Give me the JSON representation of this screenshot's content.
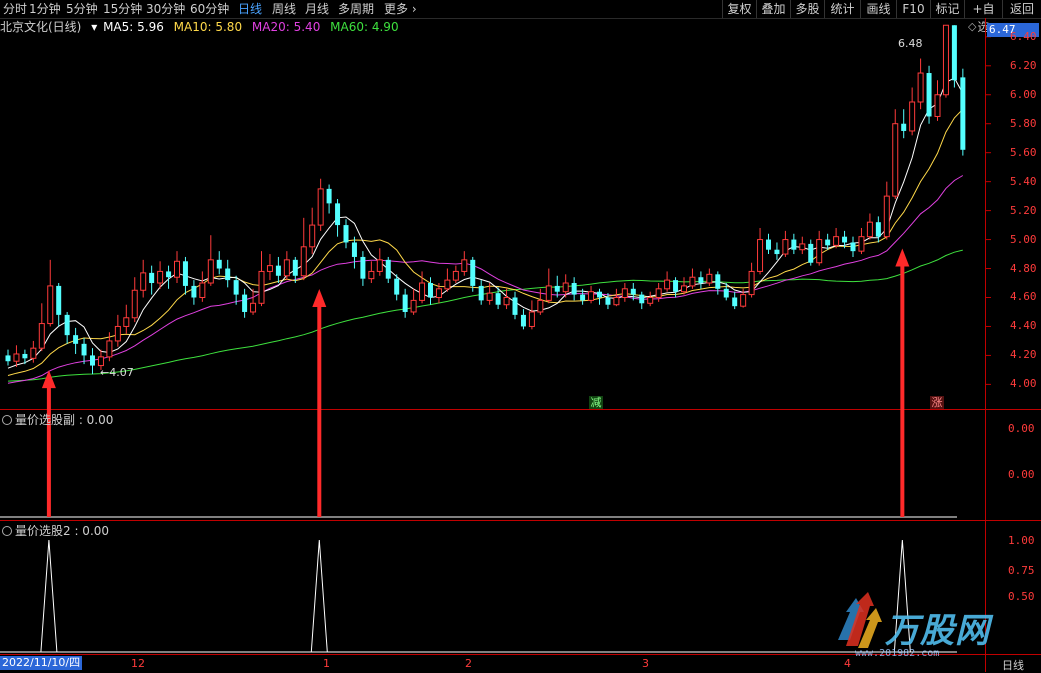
{
  "toolbar": {
    "left_items": [
      "分时",
      "1分钟",
      "5分钟",
      "15分钟",
      "30分钟",
      "60分钟",
      "日线",
      "周线",
      "月线",
      "多周期",
      "更多"
    ],
    "active": "日线",
    "right_items": [
      "复权",
      "叠加",
      "多股",
      "统计",
      "画线",
      "F10",
      "标记",
      "+自选",
      "返回"
    ]
  },
  "stock": {
    "title": "北京文化(日线)"
  },
  "ma_legend": [
    {
      "label": "MA5: 5.96",
      "color": "#ffffff"
    },
    {
      "label": "MA10: 5.80",
      "color": "#ffd94a"
    },
    {
      "label": "MA20: 5.40",
      "color": "#e040e0"
    },
    {
      "label": "MA60: 4.90",
      "color": "#3ee03e"
    }
  ],
  "price_axis": {
    "current": "6.47",
    "ticks": [
      "6.40",
      "6.20",
      "6.00",
      "5.80",
      "5.60",
      "5.40",
      "5.20",
      "5.00",
      "4.80",
      "4.60",
      "4.40",
      "4.20",
      "4.00"
    ]
  },
  "annotations": {
    "high": "6.48",
    "low": "4.07",
    "tag_down": "减",
    "tag_up": "涨"
  },
  "panel2": {
    "title": "量价选股副 : 0.00",
    "ticks": [
      "0.00",
      "0.00"
    ]
  },
  "panel3": {
    "title": "量价选股2 : 0.00",
    "ticks": [
      "1.00",
      "0.75",
      "0.50"
    ]
  },
  "date_axis": {
    "cursor": "2022/11/10/四",
    "labels": [
      "12",
      "1",
      "2",
      "3",
      "4"
    ],
    "period": "日线"
  },
  "watermark": {
    "text": "万股网",
    "url": "www.201982.com"
  },
  "colors": {
    "up": "#ff3b3b",
    "down": "#54ffff",
    "ma5": "#ffffff",
    "ma10": "#ffd94a",
    "ma20": "#e040e0",
    "ma60": "#3ee03e",
    "axis": "#c00000",
    "active": "#4aa3ff"
  },
  "chart_data": {
    "type": "candlestick",
    "price_range": [
      3.83,
      6.53
    ],
    "signals": [
      2,
      34,
      103
    ],
    "candles": [
      {
        "o": 4.2,
        "c": 4.16,
        "h": 4.24,
        "l": 4.13
      },
      {
        "o": 4.16,
        "c": 4.21,
        "h": 4.27,
        "l": 4.12
      },
      {
        "o": 4.21,
        "c": 4.18,
        "h": 4.24,
        "l": 4.14
      },
      {
        "o": 4.18,
        "c": 4.25,
        "h": 4.3,
        "l": 4.15
      },
      {
        "o": 4.25,
        "c": 4.42,
        "h": 4.56,
        "l": 4.23
      },
      {
        "o": 4.42,
        "c": 4.68,
        "h": 4.86,
        "l": 4.4
      },
      {
        "o": 4.68,
        "c": 4.48,
        "h": 4.7,
        "l": 4.4
      },
      {
        "o": 4.48,
        "c": 4.34,
        "h": 4.5,
        "l": 4.28
      },
      {
        "o": 4.34,
        "c": 4.28,
        "h": 4.39,
        "l": 4.21
      },
      {
        "o": 4.28,
        "c": 4.2,
        "h": 4.32,
        "l": 4.14
      },
      {
        "o": 4.2,
        "c": 4.13,
        "h": 4.25,
        "l": 4.07
      },
      {
        "o": 4.13,
        "c": 4.19,
        "h": 4.24,
        "l": 4.1
      },
      {
        "o": 4.19,
        "c": 4.3,
        "h": 4.36,
        "l": 4.16
      },
      {
        "o": 4.3,
        "c": 4.4,
        "h": 4.48,
        "l": 4.26
      },
      {
        "o": 4.4,
        "c": 4.46,
        "h": 4.55,
        "l": 4.35
      },
      {
        "o": 4.46,
        "c": 4.65,
        "h": 4.74,
        "l": 4.43
      },
      {
        "o": 4.65,
        "c": 4.77,
        "h": 4.86,
        "l": 4.6
      },
      {
        "o": 4.77,
        "c": 4.7,
        "h": 4.82,
        "l": 4.62
      },
      {
        "o": 4.7,
        "c": 4.78,
        "h": 4.85,
        "l": 4.66
      },
      {
        "o": 4.78,
        "c": 4.74,
        "h": 4.82,
        "l": 4.66
      },
      {
        "o": 4.74,
        "c": 4.85,
        "h": 4.92,
        "l": 4.7
      },
      {
        "o": 4.85,
        "c": 4.68,
        "h": 4.88,
        "l": 4.62
      },
      {
        "o": 4.68,
        "c": 4.6,
        "h": 4.72,
        "l": 4.55
      },
      {
        "o": 4.6,
        "c": 4.7,
        "h": 4.78,
        "l": 4.57
      },
      {
        "o": 4.7,
        "c": 4.86,
        "h": 5.03,
        "l": 4.68
      },
      {
        "o": 4.86,
        "c": 4.8,
        "h": 4.92,
        "l": 4.76
      },
      {
        "o": 4.8,
        "c": 4.72,
        "h": 4.86,
        "l": 4.67
      },
      {
        "o": 4.72,
        "c": 4.62,
        "h": 4.75,
        "l": 4.55
      },
      {
        "o": 4.62,
        "c": 4.5,
        "h": 4.66,
        "l": 4.46
      },
      {
        "o": 4.5,
        "c": 4.56,
        "h": 4.66,
        "l": 4.48
      },
      {
        "o": 4.56,
        "c": 4.78,
        "h": 4.92,
        "l": 4.54
      },
      {
        "o": 4.78,
        "c": 4.82,
        "h": 4.9,
        "l": 4.72
      },
      {
        "o": 4.82,
        "c": 4.75,
        "h": 4.88,
        "l": 4.7
      },
      {
        "o": 4.75,
        "c": 4.86,
        "h": 4.92,
        "l": 4.72
      },
      {
        "o": 4.86,
        "c": 4.75,
        "h": 4.88,
        "l": 4.7
      },
      {
        "o": 4.75,
        "c": 4.95,
        "h": 5.15,
        "l": 4.72
      },
      {
        "o": 4.95,
        "c": 5.1,
        "h": 5.22,
        "l": 4.9
      },
      {
        "o": 5.1,
        "c": 5.35,
        "h": 5.42,
        "l": 5.06
      },
      {
        "o": 5.35,
        "c": 5.25,
        "h": 5.38,
        "l": 5.18
      },
      {
        "o": 5.25,
        "c": 5.1,
        "h": 5.28,
        "l": 5.02
      },
      {
        "o": 5.1,
        "c": 4.98,
        "h": 5.14,
        "l": 4.94
      },
      {
        "o": 4.98,
        "c": 4.88,
        "h": 5.02,
        "l": 4.8
      },
      {
        "o": 4.88,
        "c": 4.73,
        "h": 4.92,
        "l": 4.68
      },
      {
        "o": 4.73,
        "c": 4.78,
        "h": 4.85,
        "l": 4.7
      },
      {
        "o": 4.78,
        "c": 4.86,
        "h": 4.94,
        "l": 4.75
      },
      {
        "o": 4.86,
        "c": 4.73,
        "h": 4.88,
        "l": 4.7
      },
      {
        "o": 4.73,
        "c": 4.62,
        "h": 4.76,
        "l": 4.58
      },
      {
        "o": 4.62,
        "c": 4.5,
        "h": 4.66,
        "l": 4.46
      },
      {
        "o": 4.5,
        "c": 4.58,
        "h": 4.66,
        "l": 4.48
      },
      {
        "o": 4.58,
        "c": 4.7,
        "h": 4.78,
        "l": 4.56
      },
      {
        "o": 4.7,
        "c": 4.6,
        "h": 4.74,
        "l": 4.55
      },
      {
        "o": 4.6,
        "c": 4.66,
        "h": 4.7,
        "l": 4.56
      },
      {
        "o": 4.66,
        "c": 4.72,
        "h": 4.8,
        "l": 4.64
      },
      {
        "o": 4.72,
        "c": 4.78,
        "h": 4.82,
        "l": 4.7
      },
      {
        "o": 4.78,
        "c": 4.86,
        "h": 4.92,
        "l": 4.75
      },
      {
        "o": 4.86,
        "c": 4.68,
        "h": 4.88,
        "l": 4.64
      },
      {
        "o": 4.68,
        "c": 4.58,
        "h": 4.72,
        "l": 4.55
      },
      {
        "o": 4.58,
        "c": 4.63,
        "h": 4.7,
        "l": 4.55
      },
      {
        "o": 4.63,
        "c": 4.55,
        "h": 4.67,
        "l": 4.52
      },
      {
        "o": 4.55,
        "c": 4.6,
        "h": 4.66,
        "l": 4.52
      },
      {
        "o": 4.6,
        "c": 4.48,
        "h": 4.64,
        "l": 4.45
      },
      {
        "o": 4.48,
        "c": 4.4,
        "h": 4.52,
        "l": 4.38
      },
      {
        "o": 4.4,
        "c": 4.5,
        "h": 4.58,
        "l": 4.38
      },
      {
        "o": 4.5,
        "c": 4.58,
        "h": 4.66,
        "l": 4.48
      },
      {
        "o": 4.58,
        "c": 4.68,
        "h": 4.8,
        "l": 4.56
      },
      {
        "o": 4.68,
        "c": 4.64,
        "h": 4.75,
        "l": 4.6
      },
      {
        "o": 4.64,
        "c": 4.7,
        "h": 4.76,
        "l": 4.6
      },
      {
        "o": 4.7,
        "c": 4.62,
        "h": 4.74,
        "l": 4.58
      },
      {
        "o": 4.62,
        "c": 4.58,
        "h": 4.66,
        "l": 4.55
      },
      {
        "o": 4.58,
        "c": 4.64,
        "h": 4.68,
        "l": 4.56
      },
      {
        "o": 4.64,
        "c": 4.6,
        "h": 4.66,
        "l": 4.55
      },
      {
        "o": 4.6,
        "c": 4.55,
        "h": 4.63,
        "l": 4.52
      },
      {
        "o": 4.55,
        "c": 4.6,
        "h": 4.66,
        "l": 4.54
      },
      {
        "o": 4.6,
        "c": 4.66,
        "h": 4.7,
        "l": 4.57
      },
      {
        "o": 4.66,
        "c": 4.62,
        "h": 4.7,
        "l": 4.58
      },
      {
        "o": 4.62,
        "c": 4.56,
        "h": 4.64,
        "l": 4.52
      },
      {
        "o": 4.56,
        "c": 4.6,
        "h": 4.64,
        "l": 4.54
      },
      {
        "o": 4.6,
        "c": 4.66,
        "h": 4.7,
        "l": 4.57
      },
      {
        "o": 4.66,
        "c": 4.72,
        "h": 4.78,
        "l": 4.64
      },
      {
        "o": 4.72,
        "c": 4.64,
        "h": 4.74,
        "l": 4.6
      },
      {
        "o": 4.64,
        "c": 4.68,
        "h": 4.74,
        "l": 4.62
      },
      {
        "o": 4.68,
        "c": 4.74,
        "h": 4.8,
        "l": 4.66
      },
      {
        "o": 4.74,
        "c": 4.7,
        "h": 4.78,
        "l": 4.66
      },
      {
        "o": 4.7,
        "c": 4.76,
        "h": 4.8,
        "l": 4.68
      },
      {
        "o": 4.76,
        "c": 4.66,
        "h": 4.78,
        "l": 4.62
      },
      {
        "o": 4.66,
        "c": 4.6,
        "h": 4.7,
        "l": 4.58
      },
      {
        "o": 4.6,
        "c": 4.54,
        "h": 4.64,
        "l": 4.52
      },
      {
        "o": 4.54,
        "c": 4.62,
        "h": 4.66,
        "l": 4.53
      },
      {
        "o": 4.62,
        "c": 4.78,
        "h": 4.84,
        "l": 4.6
      },
      {
        "o": 4.78,
        "c": 5.0,
        "h": 5.08,
        "l": 4.76
      },
      {
        "o": 5.0,
        "c": 4.93,
        "h": 5.04,
        "l": 4.9
      },
      {
        "o": 4.93,
        "c": 4.9,
        "h": 4.98,
        "l": 4.86
      },
      {
        "o": 4.9,
        "c": 5.0,
        "h": 5.06,
        "l": 4.88
      },
      {
        "o": 5.0,
        "c": 4.93,
        "h": 5.04,
        "l": 4.9
      },
      {
        "o": 4.93,
        "c": 4.97,
        "h": 5.02,
        "l": 4.9
      },
      {
        "o": 4.97,
        "c": 4.84,
        "h": 5.0,
        "l": 4.82
      },
      {
        "o": 4.84,
        "c": 5.0,
        "h": 5.06,
        "l": 4.82
      },
      {
        "o": 5.0,
        "c": 4.96,
        "h": 5.04,
        "l": 4.93
      },
      {
        "o": 4.96,
        "c": 5.02,
        "h": 5.08,
        "l": 4.94
      },
      {
        "o": 5.02,
        "c": 4.98,
        "h": 5.06,
        "l": 4.94
      },
      {
        "o": 4.98,
        "c": 4.92,
        "h": 5.02,
        "l": 4.88
      },
      {
        "o": 4.92,
        "c": 5.02,
        "h": 5.08,
        "l": 4.9
      },
      {
        "o": 5.02,
        "c": 5.12,
        "h": 5.18,
        "l": 5.0
      },
      {
        "o": 5.12,
        "c": 5.02,
        "h": 5.16,
        "l": 4.98
      },
      {
        "o": 5.02,
        "c": 5.3,
        "h": 5.4,
        "l": 5.0
      },
      {
        "o": 5.3,
        "c": 5.8,
        "h": 5.9,
        "l": 5.28
      },
      {
        "o": 5.8,
        "c": 5.75,
        "h": 5.9,
        "l": 5.7
      },
      {
        "o": 5.75,
        "c": 5.95,
        "h": 6.05,
        "l": 5.72
      },
      {
        "o": 5.95,
        "c": 6.15,
        "h": 6.25,
        "l": 5.9
      },
      {
        "o": 6.15,
        "c": 5.85,
        "h": 6.2,
        "l": 5.8
      },
      {
        "o": 5.85,
        "c": 6.0,
        "h": 6.1,
        "l": 5.82
      },
      {
        "o": 6.0,
        "c": 6.48,
        "h": 6.48,
        "l": 5.98
      },
      {
        "o": 6.48,
        "c": 6.1,
        "h": 6.48,
        "l": 6.05
      },
      {
        "o": 6.12,
        "c": 5.62,
        "h": 6.18,
        "l": 5.58
      }
    ]
  }
}
